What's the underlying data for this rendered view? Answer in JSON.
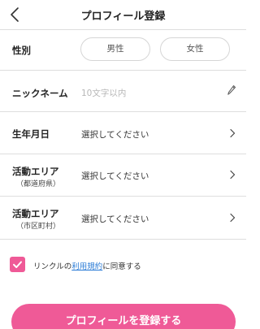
{
  "header": {
    "title": "プロフィール登録",
    "back_icon": "chevron-left-icon"
  },
  "gender": {
    "label": "性別",
    "options": [
      "男性",
      "女性"
    ]
  },
  "nickname": {
    "label": "ニックネーム",
    "placeholder": "10文字以内",
    "value": "",
    "edit_icon": "pencil-icon"
  },
  "birthdate": {
    "label": "生年月日",
    "value": "選択してください"
  },
  "area_prefecture": {
    "label": "活動エリア",
    "sublabel": "（都道府県）",
    "value": "選択してください"
  },
  "area_city": {
    "label": "活動エリア",
    "sublabel": "（市区町村）",
    "value": "選択してください"
  },
  "agreement": {
    "checked": true,
    "prefix": "リンクルの",
    "link_text": "利用規約",
    "suffix": "に同意する"
  },
  "submit_label": "プロフィールを登録する",
  "colors": {
    "accent": "#ef5a97",
    "link": "#2a7bd6",
    "divider": "#dedede"
  }
}
